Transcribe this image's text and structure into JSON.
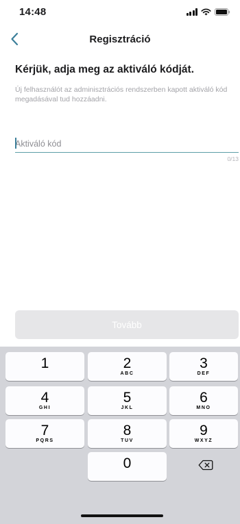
{
  "status_bar": {
    "time": "14:48",
    "icons": [
      "cellular-signal-icon",
      "wifi-icon",
      "battery-icon"
    ]
  },
  "nav": {
    "title": "Regisztráció",
    "back_icon": "chevron-left-icon"
  },
  "content": {
    "heading": "Kérjük, adja meg az aktiváló kódját.",
    "description": "Új felhasználót az adminisztrációs rendszerben kapott aktiváló kód megadásával tud hozzáadni.",
    "code_field": {
      "value": "",
      "placeholder": "Aktiváló kód",
      "counter": "0/13"
    },
    "next_button": "Tovább"
  },
  "keyboard": {
    "keys": [
      {
        "digit": "1",
        "letters": ""
      },
      {
        "digit": "2",
        "letters": "ABC"
      },
      {
        "digit": "3",
        "letters": "DEF"
      },
      {
        "digit": "4",
        "letters": "GHI"
      },
      {
        "digit": "5",
        "letters": "JKL"
      },
      {
        "digit": "6",
        "letters": "MNO"
      },
      {
        "digit": "7",
        "letters": "PQRS"
      },
      {
        "digit": "8",
        "letters": "TUV"
      },
      {
        "digit": "9",
        "letters": "WXYZ"
      },
      {
        "digit": "0",
        "letters": ""
      }
    ],
    "delete_icon": "backspace-icon"
  },
  "colors": {
    "accent": "#3c7f9a",
    "field_underline": "#5b9ea6",
    "disabled_button": "#e6e6e8",
    "keyboard_background": "#d3d4d9"
  }
}
